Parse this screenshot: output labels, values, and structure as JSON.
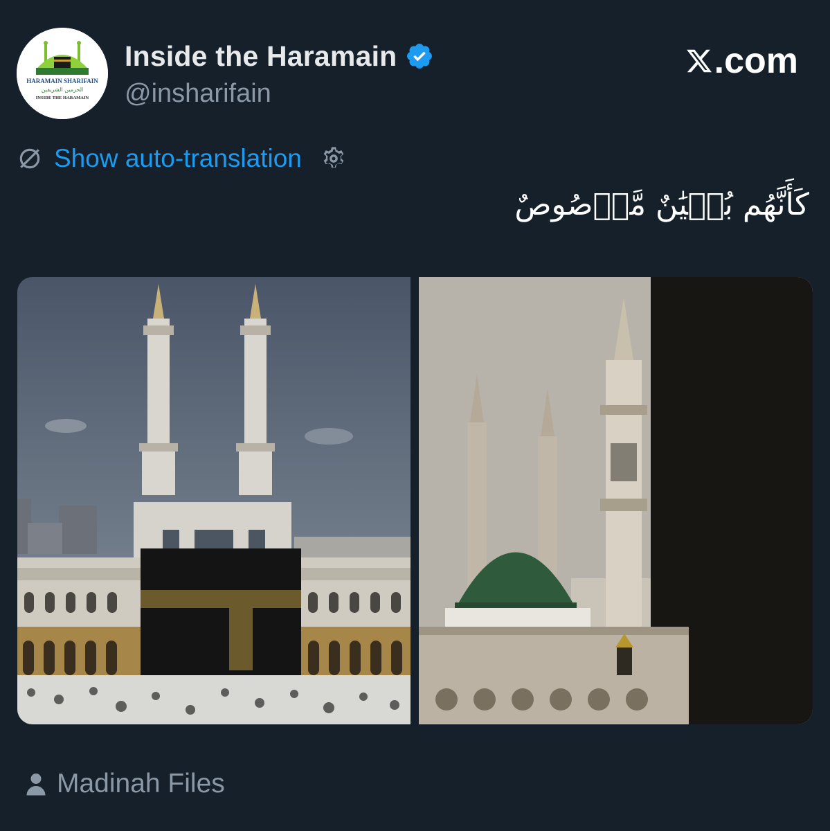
{
  "profile": {
    "display_name": "Inside the Haramain",
    "handle": "@insharifain",
    "verified": true,
    "avatar_lettering": [
      "HARAMAIN SHARIFAIN",
      "الحرمين الشريفين",
      "INSIDE THE HARAMAIN"
    ]
  },
  "brand": {
    "label": ".com",
    "icon": "x-logo-icon"
  },
  "translation": {
    "link_text": "Show auto-translation",
    "icon": "no-translation-icon",
    "settings_icon": "gear-icon"
  },
  "post": {
    "text": "كَأَنَّهُم بُنۡيَٰنٌ مَّرۡصُوصٌ"
  },
  "media": {
    "images": [
      {
        "name": "kaaba-photo",
        "subject": "Kaaba with minarets and pilgrims"
      },
      {
        "name": "green-dome-photo",
        "subject": "Green Dome and minarets of Masjid an-Nabawi"
      }
    ]
  },
  "source": {
    "label": "Madinah Files",
    "icon": "person-icon"
  },
  "colors": {
    "background": "#15202b",
    "primary_text": "#e7e9ea",
    "secondary_text": "#8b98a5",
    "link": "#1d9bf0",
    "verified": "#1d9bf0"
  }
}
